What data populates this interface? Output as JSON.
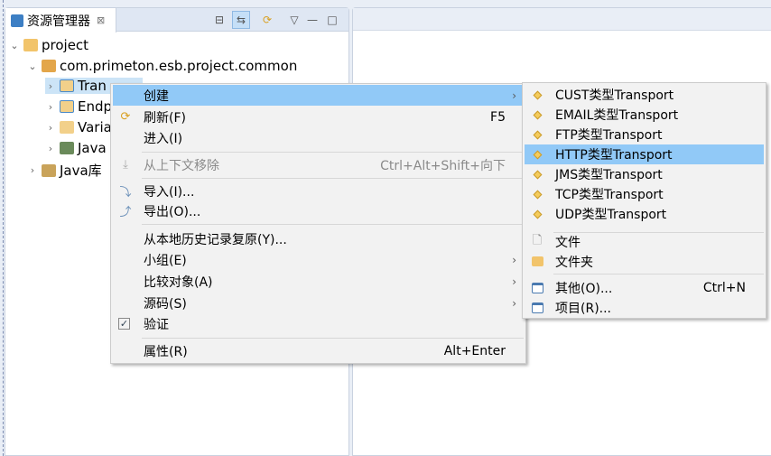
{
  "explorer": {
    "tab_title": "资源管理器",
    "close": "⊠"
  },
  "tree": [
    {
      "label": "project"
    },
    {
      "label": "com.primeton.esb.project.common"
    },
    {
      "label": "Tran"
    },
    {
      "label": "Endp"
    },
    {
      "label": "Varia"
    },
    {
      "label": "Java"
    },
    {
      "label": "Java库"
    }
  ],
  "menu": {
    "create": "创建",
    "refresh": "刷新(F)",
    "refresh_sc": "F5",
    "enter": "进入(I)",
    "remove": "从上下文移除",
    "remove_sc": "Ctrl+Alt+Shift+向下",
    "import": "导入(I)...",
    "export": "导出(O)...",
    "restore": "从本地历史记录复原(Y)...",
    "team": "小组(E)",
    "compare": "比较对象(A)",
    "source": "源码(S)",
    "validate": "验证",
    "properties": "属性(R)",
    "properties_sc": "Alt+Enter"
  },
  "submenu": {
    "transports": [
      "CUST类型Transport",
      "EMAIL类型Transport",
      "FTP类型Transport",
      "HTTP类型Transport",
      "JMS类型Transport",
      "TCP类型Transport",
      "UDP类型Transport"
    ],
    "file": "文件",
    "folder": "文件夹",
    "other": "其他(O)...",
    "other_sc": "Ctrl+N",
    "project": "项目(R)..."
  },
  "colors": {
    "highlight": "#91c9f7",
    "menu_bg": "#f2f2f2"
  }
}
